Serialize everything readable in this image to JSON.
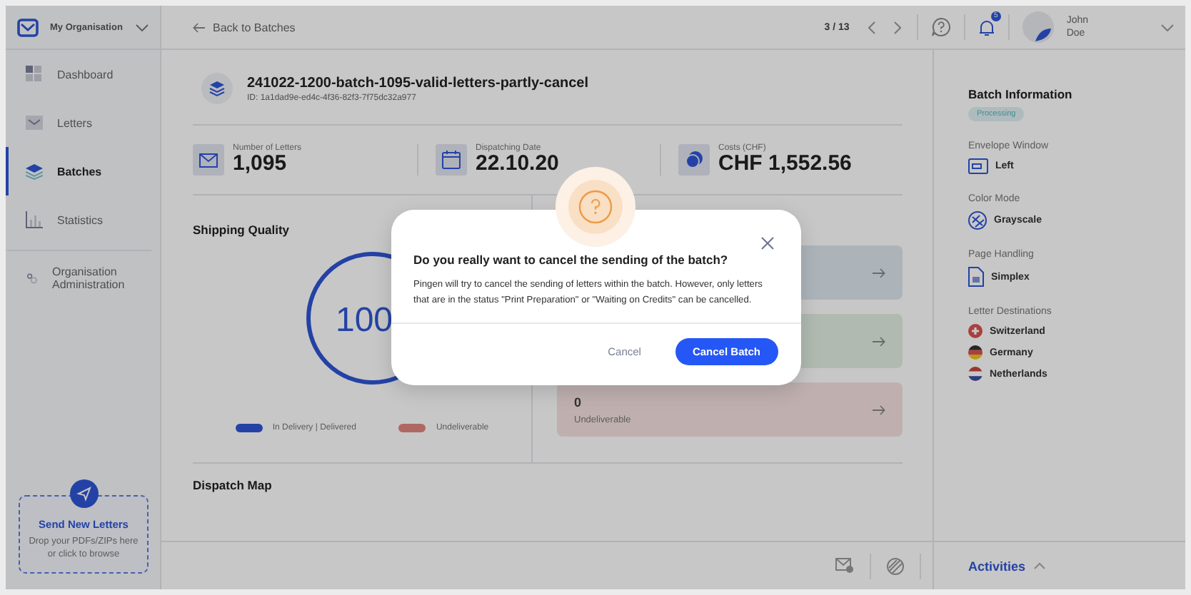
{
  "sidebar": {
    "org": "My Organisation",
    "items": [
      {
        "label": "Dashboard",
        "kind": "dashboard",
        "selected": false
      },
      {
        "label": "Letters",
        "kind": "letters",
        "selected": false
      },
      {
        "label": "Batches",
        "kind": "batches",
        "selected": true
      },
      {
        "label": "Statistics",
        "kind": "statistics",
        "selected": false
      },
      {
        "label": "Organisation Administration",
        "kind": "admin",
        "selected": false
      }
    ],
    "upload": {
      "title": "Send New Letters",
      "hint": "Drop your PDFs/ZIPs here or click to browse"
    }
  },
  "topbar": {
    "back": "Back to Batches",
    "pager": "3 / 13",
    "notification_count": "5",
    "user_first": "John",
    "user_last": "Doe"
  },
  "batch": {
    "name": "241022-1200-batch-1095-valid-letters-partly-cancel",
    "id": "ID: 1a1dad9e-ed4c-4f36-82f3-7f75dc32a977"
  },
  "stats": [
    {
      "kind": "letters",
      "label": "Number of Letters",
      "value": "1,095"
    },
    {
      "kind": "date",
      "label": "Dispatching Date",
      "value": "22.10.20"
    },
    {
      "kind": "cost",
      "label": "Costs (CHF)",
      "value": "CHF 1,552.56"
    }
  ],
  "shipping_quality": {
    "title": "Shipping Quality",
    "score": "100",
    "legend": [
      {
        "label": "In Delivery | Delivered",
        "color": "#2542a5"
      },
      {
        "label": "Undeliverable",
        "color": "#af6861"
      }
    ]
  },
  "status_cards": [
    {
      "color": "#acb4ba"
    },
    {
      "color": "#b0bab0"
    },
    {
      "count": "0",
      "label": "Undeliverable",
      "color": "#bfb0af"
    }
  ],
  "dispatch_map": {
    "title": "Dispatch Map"
  },
  "batch_info": {
    "title": "Batch Information",
    "status": "Processing",
    "sections": [
      {
        "kind": "envelope",
        "label": "Envelope Window",
        "value": "Left"
      },
      {
        "kind": "color",
        "label": "Color Mode",
        "value": "Grayscale"
      },
      {
        "kind": "page",
        "label": "Page Handling",
        "value": "Simplex"
      }
    ],
    "destinations_label": "Letter Destinations",
    "destinations": [
      {
        "name": "Switzerland",
        "kind": "ch"
      },
      {
        "name": "Germany",
        "kind": "de"
      },
      {
        "name": "Netherlands",
        "kind": "nl"
      }
    ]
  },
  "activities": {
    "label": "Activities"
  },
  "dialog": {
    "title": "Do you really want to cancel the sending of the batch?",
    "message": "Pingen will try to cancel the sending of letters within the batch. However, only letters that are in the status \"Print Preparation\" or \"Waiting on Credits\" can be cancelled.",
    "buttons": [
      {
        "label": "Cancel",
        "kind": "secondary"
      },
      {
        "label": "Cancel Batch",
        "kind": "primary"
      }
    ]
  }
}
